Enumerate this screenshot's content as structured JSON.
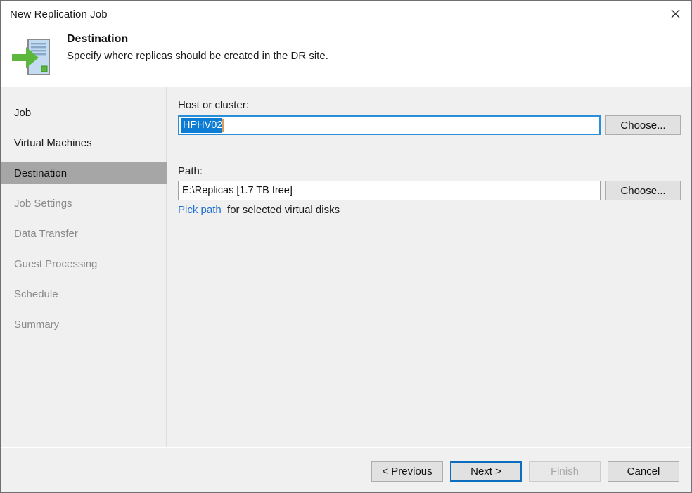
{
  "window": {
    "title": "New Replication Job",
    "close_icon": "close-icon"
  },
  "header": {
    "icon": "replication-destination-server-icon",
    "title": "Destination",
    "subtitle": "Specify where replicas should be created in the DR site."
  },
  "sidebar": {
    "items": [
      {
        "label": "Job",
        "state": "done"
      },
      {
        "label": "Virtual Machines",
        "state": "done"
      },
      {
        "label": "Destination",
        "state": "active"
      },
      {
        "label": "Job Settings",
        "state": "pending"
      },
      {
        "label": "Data Transfer",
        "state": "pending"
      },
      {
        "label": "Guest Processing",
        "state": "pending"
      },
      {
        "label": "Schedule",
        "state": "pending"
      },
      {
        "label": "Summary",
        "state": "pending"
      }
    ]
  },
  "main": {
    "host_label": "Host or cluster:",
    "host_value": "HPHV02",
    "host_choose_label": "Choose...",
    "path_label": "Path:",
    "path_value": "E:\\Replicas [1.7 TB free]",
    "path_choose_label": "Choose...",
    "hint_link": "Pick path",
    "hint_text": "for selected virtual disks"
  },
  "footer": {
    "previous_label": "< Previous",
    "next_label": "Next >",
    "finish_label": "Finish",
    "cancel_label": "Cancel"
  },
  "colors": {
    "accent_blue": "#0d6ebf",
    "selection_blue": "#0c7cd5",
    "link_blue": "#1f6fd0",
    "icon_green": "#5bb83c",
    "active_nav_gray": "#a6a6a6",
    "body_gray": "#f0f0f0"
  }
}
